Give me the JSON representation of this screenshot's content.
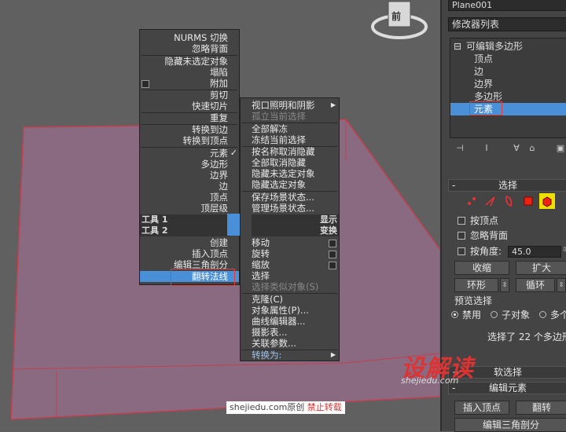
{
  "viewcube": {
    "label": "前"
  },
  "panel": {
    "object_name": "Plane001",
    "modifier_list": "修改器列表",
    "stack": {
      "root": "可编辑多边形",
      "items": [
        "顶点",
        "边",
        "边界",
        "多边形",
        "元素"
      ],
      "selected": "元素"
    },
    "selection_rollout": "选择",
    "by_vertex": "按顶点",
    "ignore_backfacing": "忽略背面",
    "by_angle": "按角度:",
    "angle_value": "45.0",
    "shrink": "收缩",
    "grow": "扩大",
    "ring": "环形",
    "loop": "循环",
    "preview_selection": "预览选择",
    "preview_options": [
      "禁用",
      "子对象",
      "多个"
    ],
    "selected_info": "选择了 22 个多边形",
    "soft_selection": "软选择",
    "edit_elements": "编辑元素",
    "insert_vertex": "插入顶点",
    "flip": "翻转",
    "edit_triangulation": "编辑三角剖分"
  },
  "quad_left": {
    "group1": [
      "NURMS 切换",
      "忽略背面"
    ],
    "group2": [
      "隐藏未选定对象",
      "塌陷",
      "附加"
    ],
    "group3": [
      "剪切",
      "快速切片"
    ],
    "group4": [
      "重复"
    ],
    "group5": [
      "转换到边",
      "转换到顶点"
    ],
    "group6": [
      "元素",
      "多边形",
      "边界",
      "边",
      "顶点",
      "顶层级"
    ],
    "check_mark": "✓",
    "header_tools1": "工具 1",
    "header_tools2": "工具 2",
    "group7": [
      "创建",
      "插入顶点",
      "编辑三角剖分",
      "翻转法线"
    ]
  },
  "quad_right": {
    "group1": [
      "视口照明和阴影",
      "孤立当前选择"
    ],
    "group2": [
      "全部解冻",
      "冻结当前选择"
    ],
    "group3": [
      "按名称取消隐藏",
      "全部取消隐藏",
      "隐藏未选定对象",
      "隐藏选定对象"
    ],
    "group4": [
      "保存场景状态...",
      "管理场景状态..."
    ],
    "header_display": "显示",
    "header_transform": "变换",
    "group5": [
      "移动",
      "旋转",
      "缩放",
      "选择",
      "选择类似对象(S)"
    ],
    "group6": [
      "克隆(C)",
      "对象属性(P)...",
      "曲线编辑器...",
      "摄影表...",
      "关联参数..."
    ],
    "group7": [
      "转换为:"
    ]
  },
  "watermark": {
    "brand": "设解读",
    "url": "shejiedu.com"
  },
  "credit": {
    "site": "shejiedu.com原创",
    "notice": "禁止转载"
  },
  "colors": {
    "accent": "#4a90d9",
    "plane_fill": "#8a6a80",
    "plane_edge": "#e04040"
  }
}
